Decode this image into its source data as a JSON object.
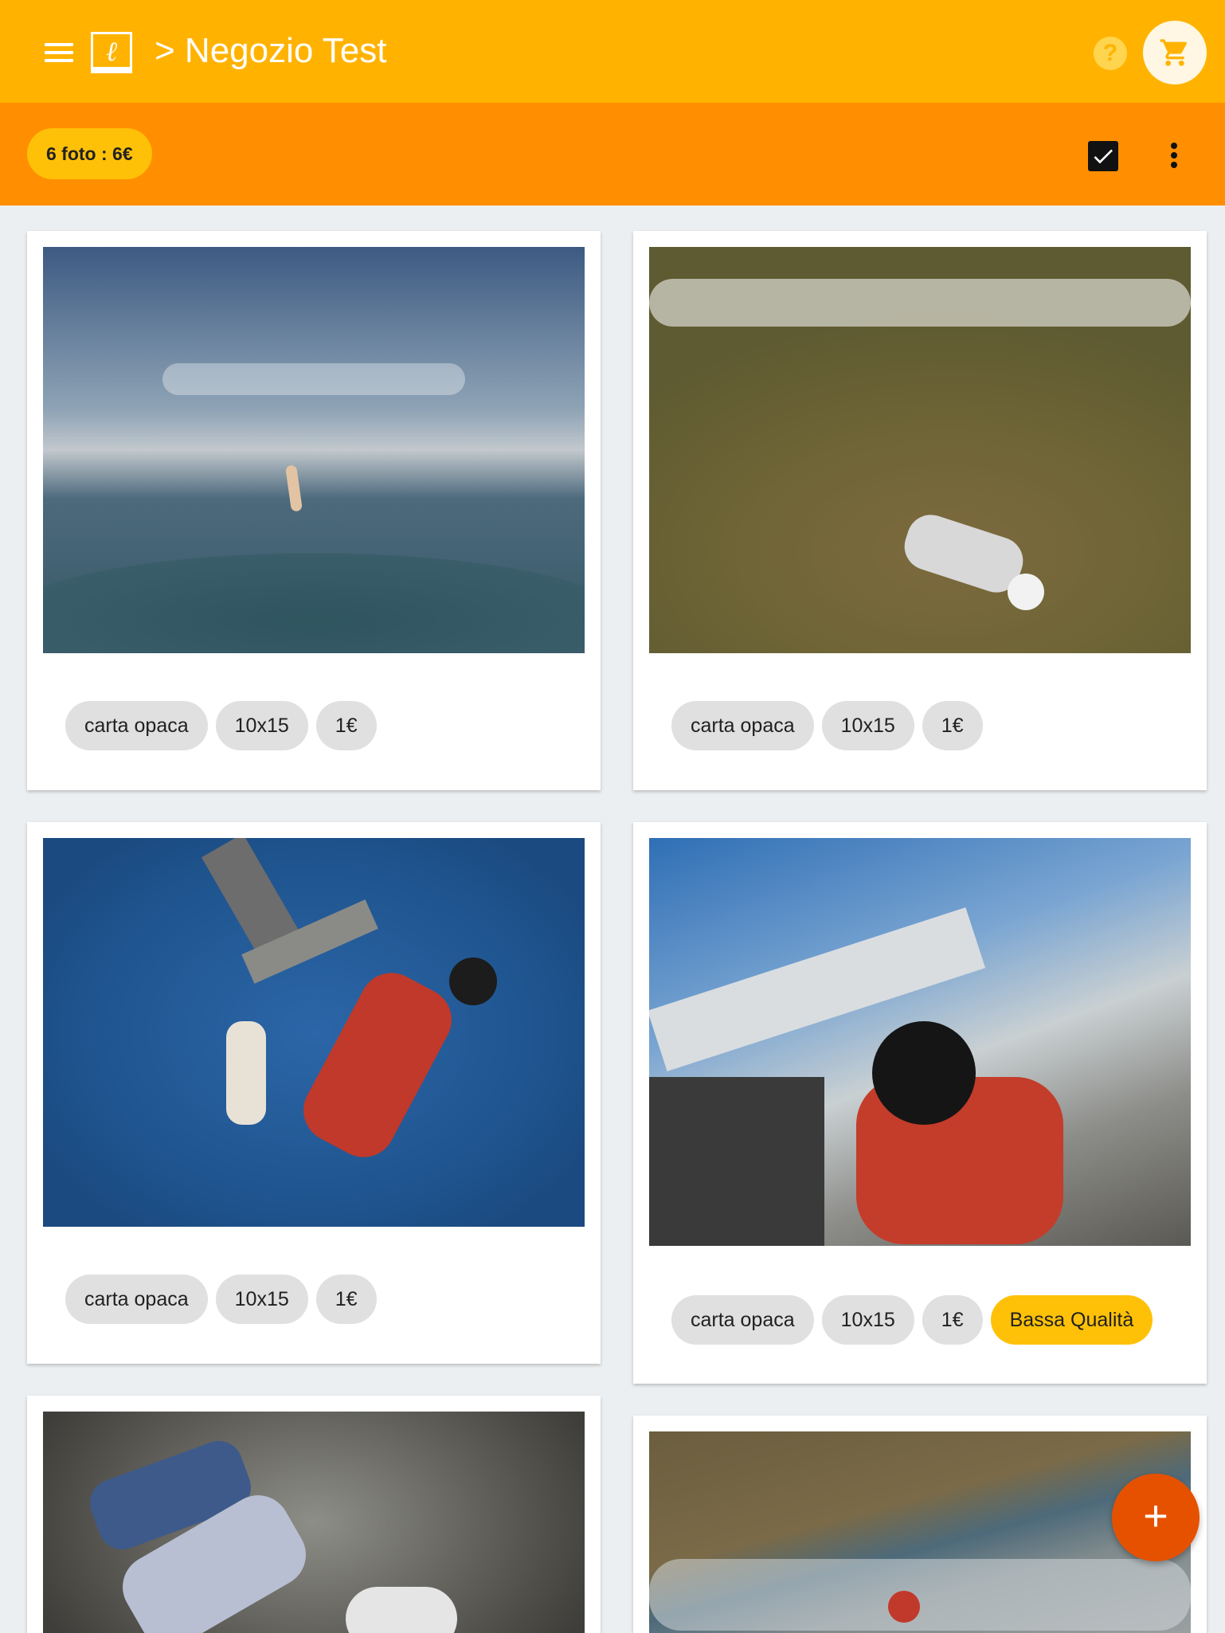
{
  "header": {
    "title": "> Negozio Test",
    "logo_letter": "ℓ",
    "help_label": "?",
    "accent_color": "#ffb300",
    "icons": [
      "menu-icon",
      "logo-icon",
      "help-icon",
      "cart-icon"
    ]
  },
  "toolbar": {
    "summary": "6 foto : 6€",
    "toolbar_color": "#ff8f00",
    "icons": [
      "checkbox-checked-icon",
      "more-vert-icon"
    ]
  },
  "photos": [
    {
      "chips": [
        "carta opaca",
        "10x15",
        "1€"
      ]
    },
    {
      "chips": [
        "carta opaca",
        "10x15",
        "1€"
      ]
    },
    {
      "chips": [
        "carta opaca",
        "10x15",
        "1€"
      ]
    },
    {
      "chips": [
        "carta opaca",
        "10x15",
        "1€"
      ],
      "quality_warning": "Bassa Qualità"
    },
    {
      "chips": []
    },
    {
      "chips": []
    }
  ],
  "fab": {
    "label": "+",
    "color": "#e65100"
  }
}
